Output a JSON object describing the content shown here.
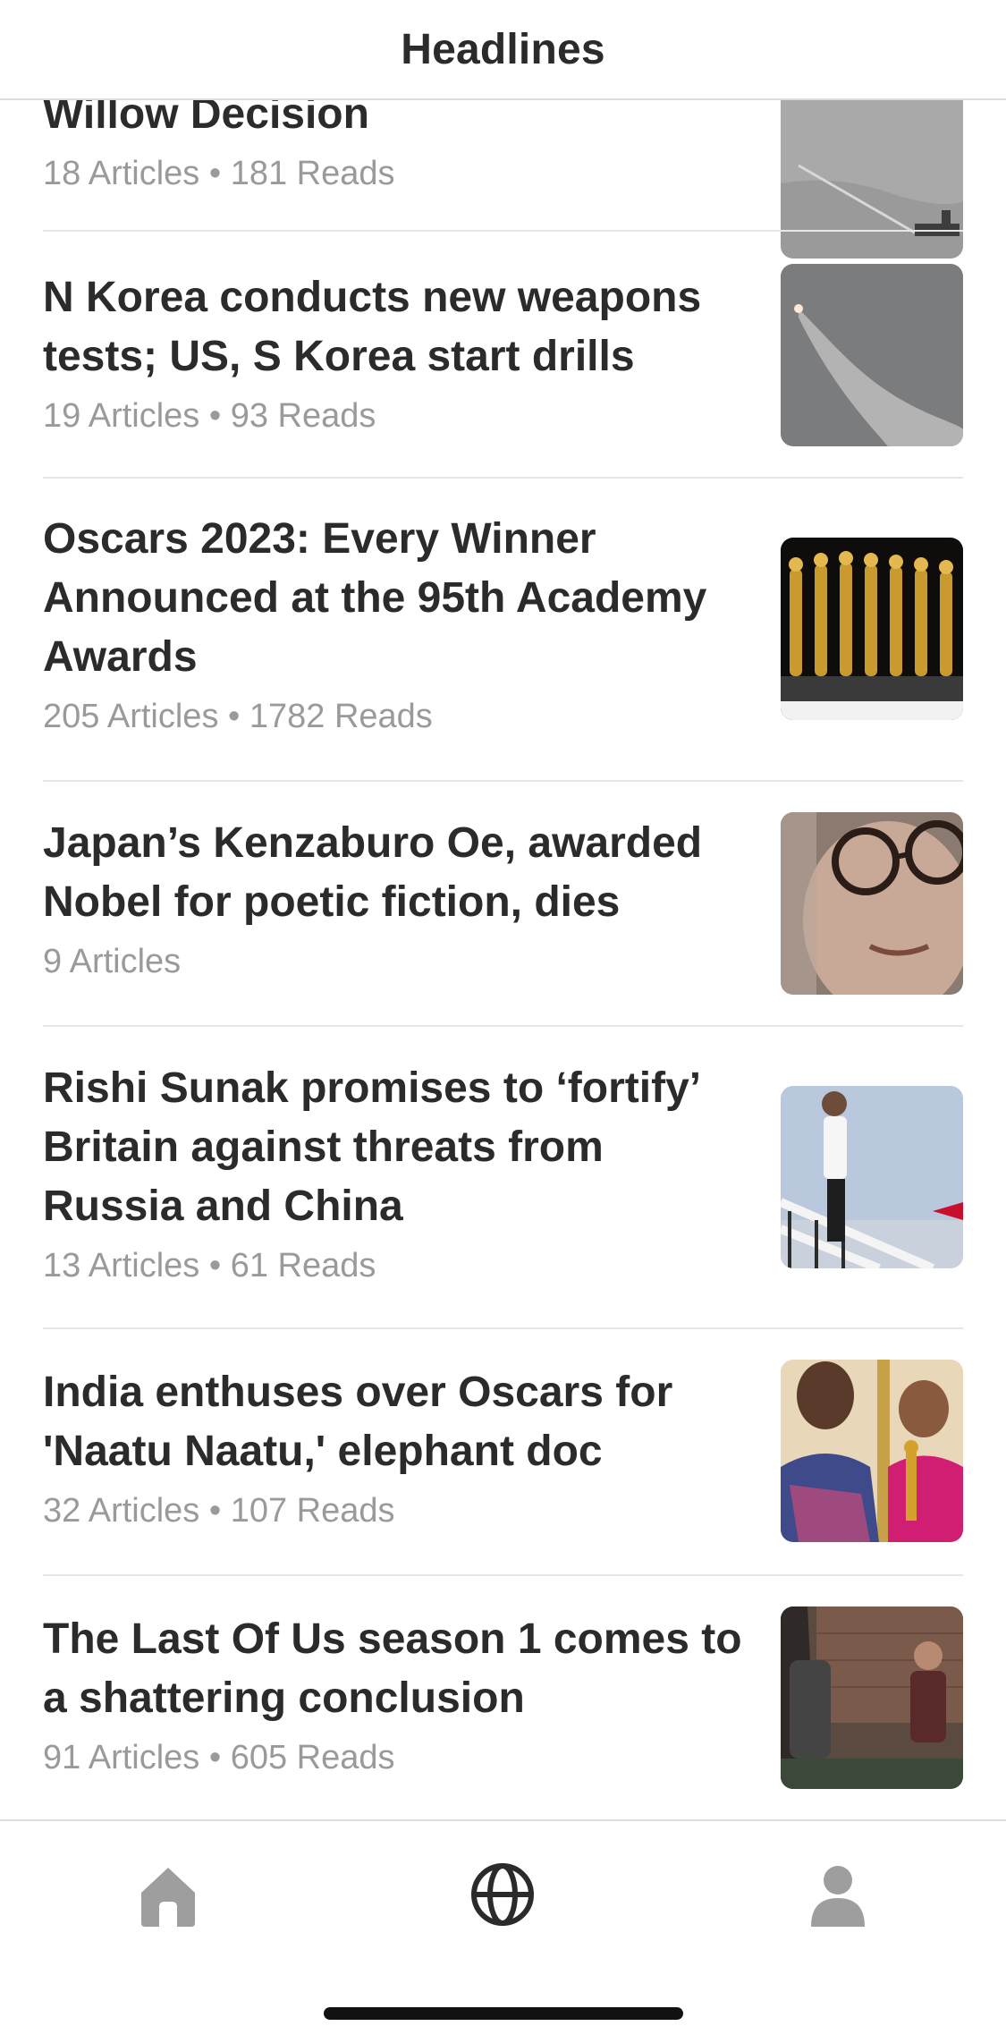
{
  "header": {
    "title": "Headlines"
  },
  "feed": {
    "items": [
      {
        "title": "Willow Decision",
        "meta": "18 Articles • 181 Reads",
        "thumb_icon": "ocean-ship-image"
      },
      {
        "title": "N Korea conducts new weapons tests; US, S Korea start drills",
        "meta": "19 Articles • 93 Reads",
        "thumb_icon": "missile-launch-image"
      },
      {
        "title": "Oscars 2023: Every Winner Announced at the 95th Academy Awards",
        "meta": "205 Articles • 1782 Reads",
        "thumb_icon": "oscar-statuettes-image"
      },
      {
        "title": "Japan’s Kenzaburo Oe, awarded Nobel for poetic fiction, dies",
        "meta": "9 Articles",
        "thumb_icon": "portrait-glasses-image"
      },
      {
        "title": "Rishi Sunak promises to ‘fortify’ Britain against threats from Russia and China",
        "meta": "13 Articles • 61 Reads",
        "thumb_icon": "man-on-airplane-stairs-image"
      },
      {
        "title": "India enthuses over Oscars for 'Naatu Naatu,' elephant doc",
        "meta": "32 Articles • 107 Reads",
        "thumb_icon": "oscar-winners-image"
      },
      {
        "title": "The Last Of Us season 1 comes to a shattering conclusion",
        "meta": "91 Articles • 605 Reads",
        "thumb_icon": "tv-scene-image"
      }
    ]
  },
  "tabbar": {
    "home_icon": "home-icon",
    "world_icon": "globe-icon",
    "profile_icon": "person-icon",
    "active_color": "#2b2b2b",
    "inactive_color": "#9e9e9e"
  }
}
